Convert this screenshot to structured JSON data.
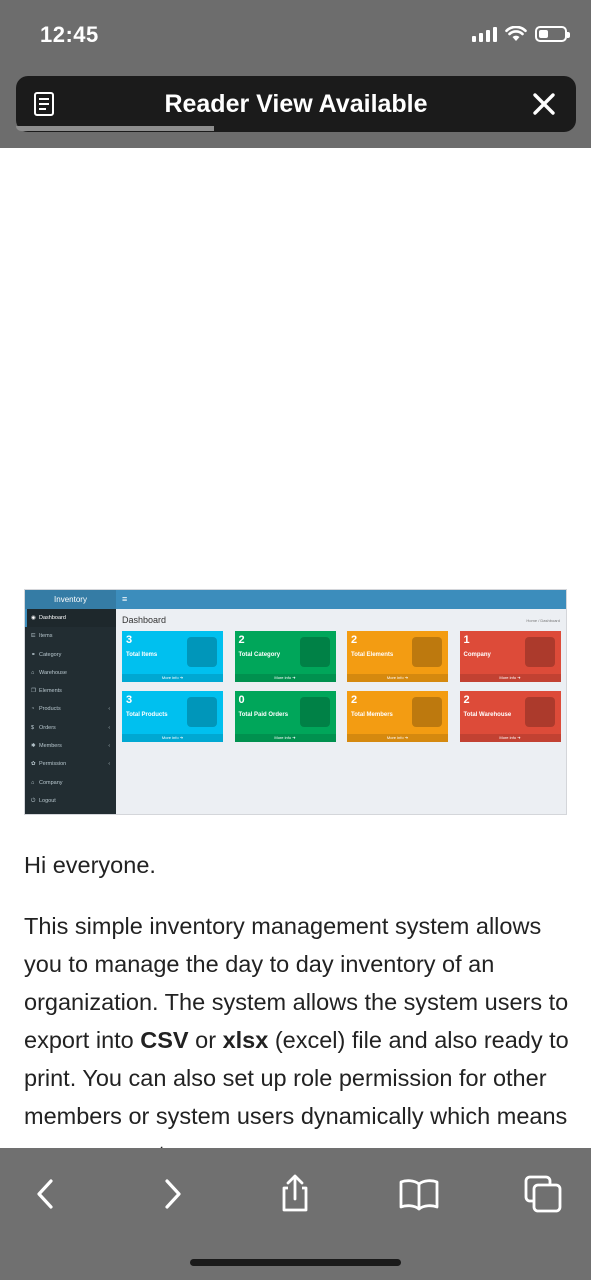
{
  "status_bar": {
    "time": "12:45"
  },
  "reader_bar": {
    "title": "Reader View Available",
    "icon": "reader-icon",
    "close_icon": "close-icon"
  },
  "admin_screenshot": {
    "brand": "Inventory",
    "menu_icon": "≡",
    "page_title": "Dashboard",
    "breadcrumb": {
      "home": "Home",
      "current": "Dashboard"
    },
    "sidebar": [
      {
        "label": "Dashboard",
        "icon": "◉",
        "active": true
      },
      {
        "label": "Items",
        "icon": "⋿"
      },
      {
        "label": "Category",
        "icon": "⚭"
      },
      {
        "label": "Warehouse",
        "icon": "⌂"
      },
      {
        "label": "Elements",
        "icon": "❐"
      },
      {
        "label": "Products",
        "icon": "◔",
        "chevron": "‹"
      },
      {
        "label": "Orders",
        "icon": "$",
        "chevron": "‹"
      },
      {
        "label": "Members",
        "icon": "✱",
        "chevron": "‹"
      },
      {
        "label": "Permission",
        "icon": "✿",
        "chevron": "‹"
      },
      {
        "label": "Company",
        "icon": "⌂"
      },
      {
        "label": "Logout",
        "icon": "⏻"
      }
    ],
    "boxes": [
      {
        "number": "3",
        "label": "Total Items",
        "more": "More info ➔",
        "color": "#00c0ef"
      },
      {
        "number": "2",
        "label": "Total Category",
        "more": "More info ➔",
        "color": "#00a65a"
      },
      {
        "number": "2",
        "label": "Total Elements",
        "more": "More info ➔",
        "color": "#f39c12"
      },
      {
        "number": "1",
        "label": "Company",
        "more": "More info ➔",
        "color": "#dd4b39"
      },
      {
        "number": "3",
        "label": "Total Products",
        "more": "More info ➔",
        "color": "#00c0ef"
      },
      {
        "number": "0",
        "label": "Total Paid Orders",
        "more": "More info ➔",
        "color": "#00a65a"
      },
      {
        "number": "2",
        "label": "Total Members",
        "more": "More info ➔",
        "color": "#f39c12"
      },
      {
        "number": "2",
        "label": "Total Warehouse",
        "more": "More info ➔",
        "color": "#dd4b39"
      }
    ]
  },
  "article": {
    "greeting": "Hi everyone.",
    "body_part1": "This simple inventory management system allows you to manage the day to day inventory of an organization. The system allows the system users to export into ",
    "bold_csv": "CSV",
    "or_text": " or ",
    "bold_xlsx": "xlsx",
    "body_part2": " (excel) file and also ready to print. You can also set up role permission for other members or system users dynamically which means you can create"
  },
  "toolbar": {
    "items": [
      "back-icon",
      "forward-icon",
      "share-icon",
      "bookmarks-icon",
      "tabs-icon"
    ]
  }
}
